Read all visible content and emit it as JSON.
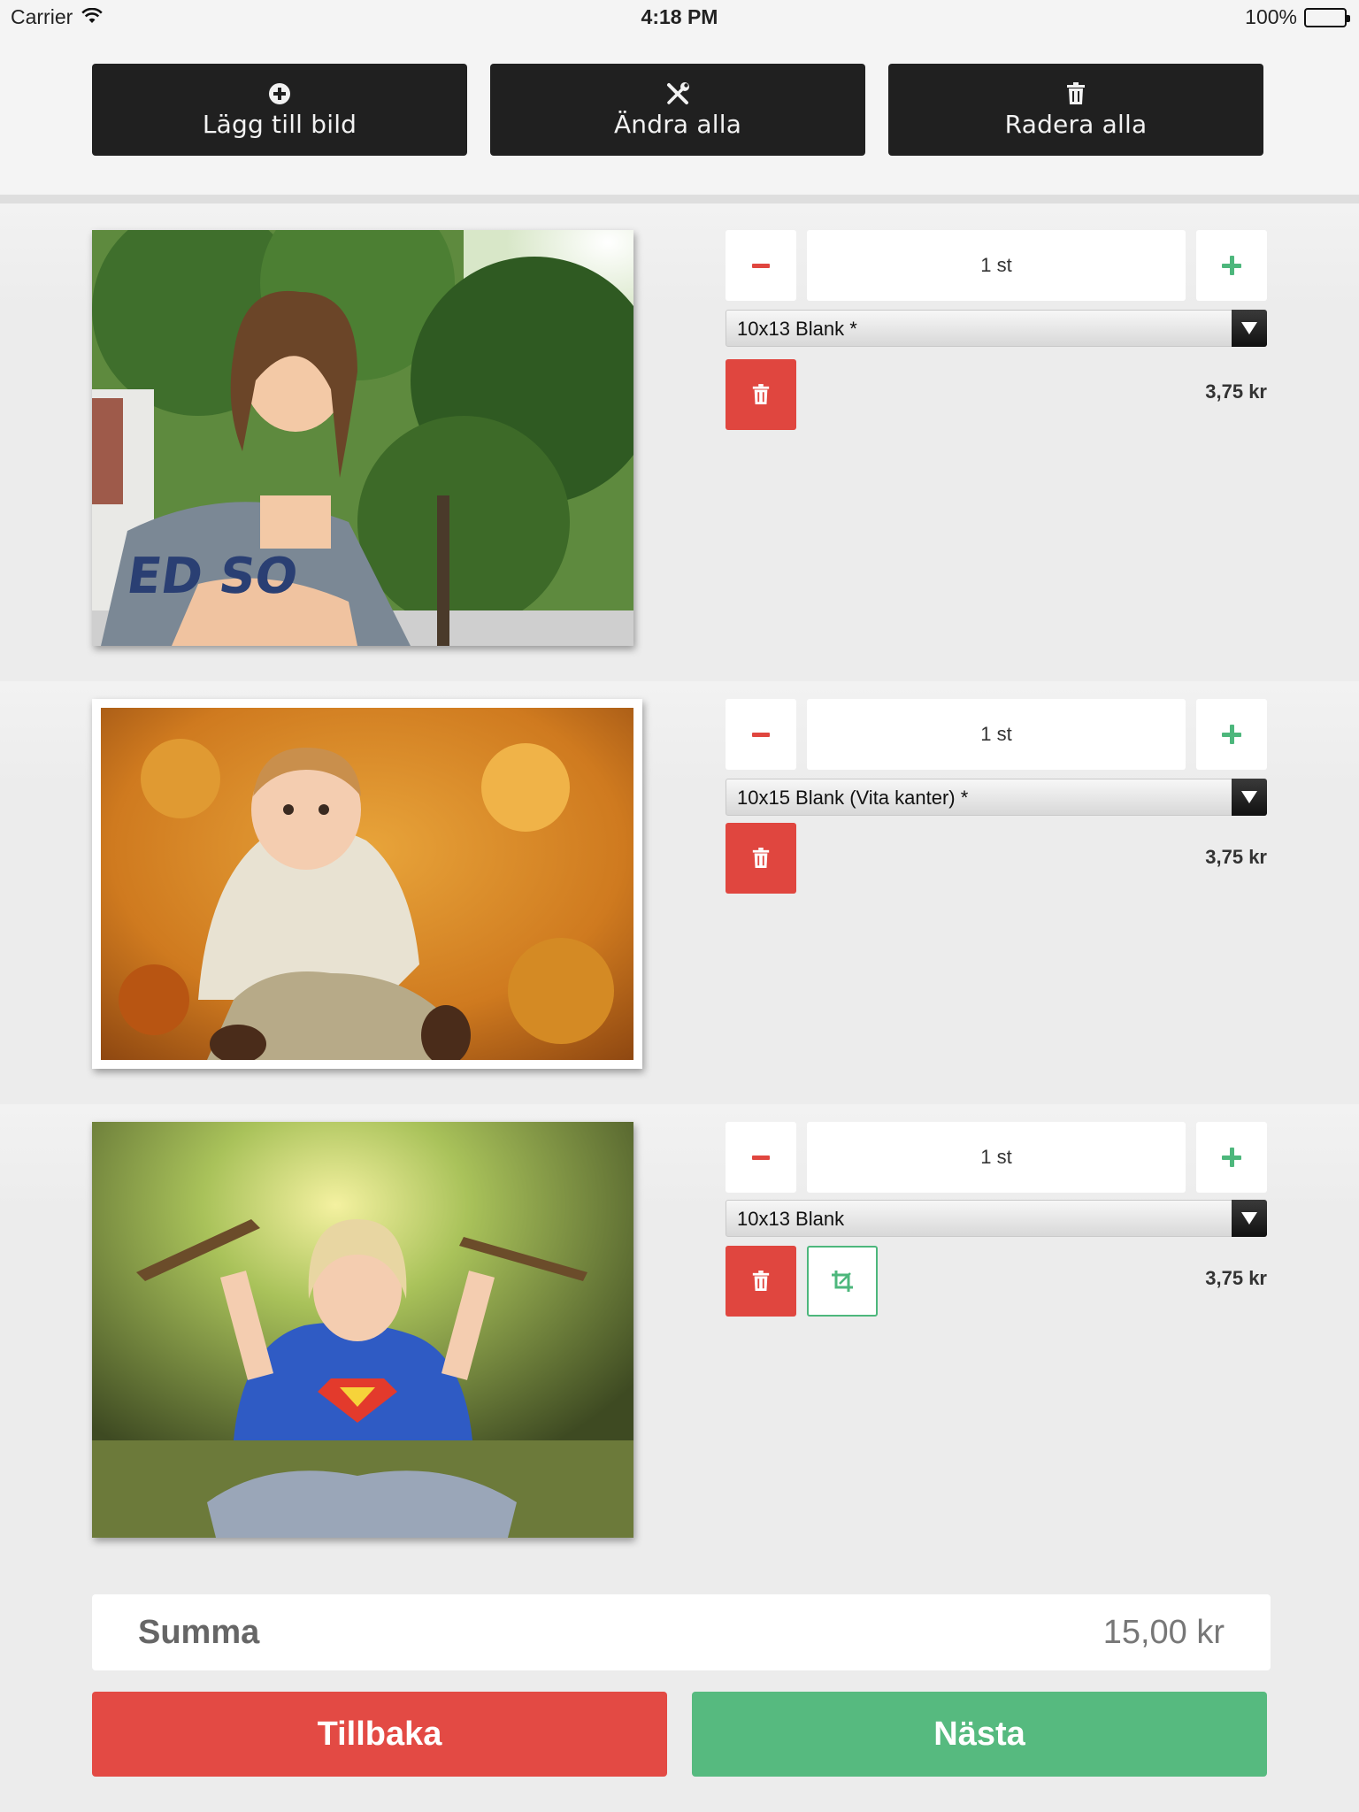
{
  "status_bar": {
    "carrier": "Carrier",
    "time": "4:18 PM",
    "battery": "100%",
    "battery_level": 1.0
  },
  "toolbar": {
    "add_label": "Lägg till bild",
    "edit_all_label": "Ändra alla",
    "delete_all_label": "Radera alla"
  },
  "items": [
    {
      "quantity": "1 st",
      "format": "10x13 Blank *",
      "price": "3,75 kr",
      "has_crop": false,
      "photo": "boy-under-tree"
    },
    {
      "quantity": "1 st",
      "format": "10x15 Blank (Vita kanter) *",
      "price": "3,75 kr",
      "has_crop": false,
      "photo": "baby-in-autumn-leaves"
    },
    {
      "quantity": "1 st",
      "format": "10x13 Blank",
      "price": "3,75 kr",
      "has_crop": true,
      "photo": "child-in-superman-shirt"
    }
  ],
  "summary": {
    "label": "Summa",
    "value": "15,00 kr"
  },
  "footer": {
    "back_label": "Tillbaka",
    "next_label": "Nästa"
  },
  "colors": {
    "toolbar_button": "#202020",
    "delete_red": "#e0463f",
    "accent_green": "#4db77c",
    "back_red": "#e34a44",
    "next_green": "#56ba7f"
  },
  "icons": [
    "wifi-icon",
    "battery-icon",
    "plus-circle-icon",
    "tools-icon",
    "trash-icon",
    "minus-icon",
    "plus-icon",
    "dropdown-arrow-icon",
    "crop-icon"
  ]
}
